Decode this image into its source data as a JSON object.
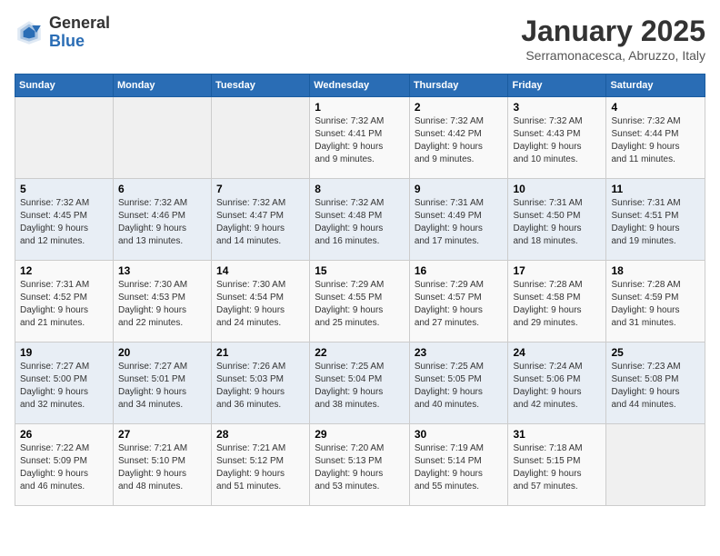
{
  "header": {
    "logo_general": "General",
    "logo_blue": "Blue",
    "month_title": "January 2025",
    "subtitle": "Serramonacesca, Abruzzo, Italy"
  },
  "weekdays": [
    "Sunday",
    "Monday",
    "Tuesday",
    "Wednesday",
    "Thursday",
    "Friday",
    "Saturday"
  ],
  "weeks": [
    [
      {
        "day": "",
        "info": ""
      },
      {
        "day": "",
        "info": ""
      },
      {
        "day": "",
        "info": ""
      },
      {
        "day": "1",
        "info": "Sunrise: 7:32 AM\nSunset: 4:41 PM\nDaylight: 9 hours\nand 9 minutes."
      },
      {
        "day": "2",
        "info": "Sunrise: 7:32 AM\nSunset: 4:42 PM\nDaylight: 9 hours\nand 9 minutes."
      },
      {
        "day": "3",
        "info": "Sunrise: 7:32 AM\nSunset: 4:43 PM\nDaylight: 9 hours\nand 10 minutes."
      },
      {
        "day": "4",
        "info": "Sunrise: 7:32 AM\nSunset: 4:44 PM\nDaylight: 9 hours\nand 11 minutes."
      }
    ],
    [
      {
        "day": "5",
        "info": "Sunrise: 7:32 AM\nSunset: 4:45 PM\nDaylight: 9 hours\nand 12 minutes."
      },
      {
        "day": "6",
        "info": "Sunrise: 7:32 AM\nSunset: 4:46 PM\nDaylight: 9 hours\nand 13 minutes."
      },
      {
        "day": "7",
        "info": "Sunrise: 7:32 AM\nSunset: 4:47 PM\nDaylight: 9 hours\nand 14 minutes."
      },
      {
        "day": "8",
        "info": "Sunrise: 7:32 AM\nSunset: 4:48 PM\nDaylight: 9 hours\nand 16 minutes."
      },
      {
        "day": "9",
        "info": "Sunrise: 7:31 AM\nSunset: 4:49 PM\nDaylight: 9 hours\nand 17 minutes."
      },
      {
        "day": "10",
        "info": "Sunrise: 7:31 AM\nSunset: 4:50 PM\nDaylight: 9 hours\nand 18 minutes."
      },
      {
        "day": "11",
        "info": "Sunrise: 7:31 AM\nSunset: 4:51 PM\nDaylight: 9 hours\nand 19 minutes."
      }
    ],
    [
      {
        "day": "12",
        "info": "Sunrise: 7:31 AM\nSunset: 4:52 PM\nDaylight: 9 hours\nand 21 minutes."
      },
      {
        "day": "13",
        "info": "Sunrise: 7:30 AM\nSunset: 4:53 PM\nDaylight: 9 hours\nand 22 minutes."
      },
      {
        "day": "14",
        "info": "Sunrise: 7:30 AM\nSunset: 4:54 PM\nDaylight: 9 hours\nand 24 minutes."
      },
      {
        "day": "15",
        "info": "Sunrise: 7:29 AM\nSunset: 4:55 PM\nDaylight: 9 hours\nand 25 minutes."
      },
      {
        "day": "16",
        "info": "Sunrise: 7:29 AM\nSunset: 4:57 PM\nDaylight: 9 hours\nand 27 minutes."
      },
      {
        "day": "17",
        "info": "Sunrise: 7:28 AM\nSunset: 4:58 PM\nDaylight: 9 hours\nand 29 minutes."
      },
      {
        "day": "18",
        "info": "Sunrise: 7:28 AM\nSunset: 4:59 PM\nDaylight: 9 hours\nand 31 minutes."
      }
    ],
    [
      {
        "day": "19",
        "info": "Sunrise: 7:27 AM\nSunset: 5:00 PM\nDaylight: 9 hours\nand 32 minutes."
      },
      {
        "day": "20",
        "info": "Sunrise: 7:27 AM\nSunset: 5:01 PM\nDaylight: 9 hours\nand 34 minutes."
      },
      {
        "day": "21",
        "info": "Sunrise: 7:26 AM\nSunset: 5:03 PM\nDaylight: 9 hours\nand 36 minutes."
      },
      {
        "day": "22",
        "info": "Sunrise: 7:25 AM\nSunset: 5:04 PM\nDaylight: 9 hours\nand 38 minutes."
      },
      {
        "day": "23",
        "info": "Sunrise: 7:25 AM\nSunset: 5:05 PM\nDaylight: 9 hours\nand 40 minutes."
      },
      {
        "day": "24",
        "info": "Sunrise: 7:24 AM\nSunset: 5:06 PM\nDaylight: 9 hours\nand 42 minutes."
      },
      {
        "day": "25",
        "info": "Sunrise: 7:23 AM\nSunset: 5:08 PM\nDaylight: 9 hours\nand 44 minutes."
      }
    ],
    [
      {
        "day": "26",
        "info": "Sunrise: 7:22 AM\nSunset: 5:09 PM\nDaylight: 9 hours\nand 46 minutes."
      },
      {
        "day": "27",
        "info": "Sunrise: 7:21 AM\nSunset: 5:10 PM\nDaylight: 9 hours\nand 48 minutes."
      },
      {
        "day": "28",
        "info": "Sunrise: 7:21 AM\nSunset: 5:12 PM\nDaylight: 9 hours\nand 51 minutes."
      },
      {
        "day": "29",
        "info": "Sunrise: 7:20 AM\nSunset: 5:13 PM\nDaylight: 9 hours\nand 53 minutes."
      },
      {
        "day": "30",
        "info": "Sunrise: 7:19 AM\nSunset: 5:14 PM\nDaylight: 9 hours\nand 55 minutes."
      },
      {
        "day": "31",
        "info": "Sunrise: 7:18 AM\nSunset: 5:15 PM\nDaylight: 9 hours\nand 57 minutes."
      },
      {
        "day": "",
        "info": ""
      }
    ]
  ]
}
